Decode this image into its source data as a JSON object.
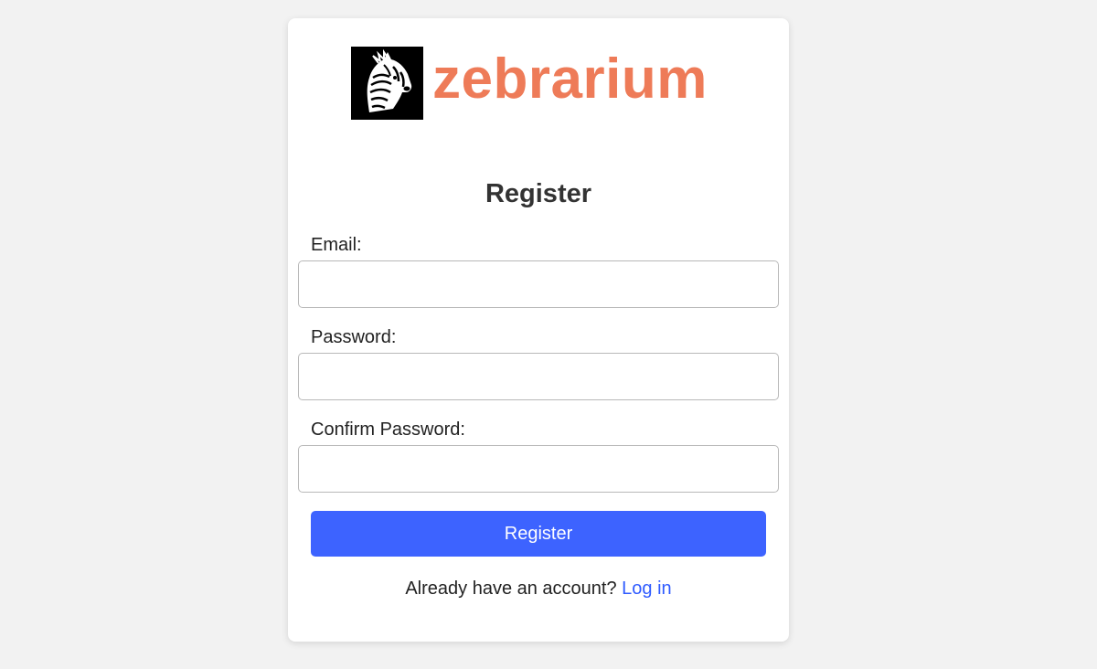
{
  "brand": {
    "logo_icon": "zebra-head-icon",
    "name": "zebrarium",
    "name_color": "#ee7b58"
  },
  "form": {
    "title": "Register",
    "fields": [
      {
        "label": "Email:",
        "value": "",
        "placeholder": ""
      },
      {
        "label": "Password:",
        "value": "",
        "placeholder": ""
      },
      {
        "label": "Confirm Password:",
        "value": "",
        "placeholder": ""
      }
    ],
    "submit_label": "Register",
    "submit_color": "#3d63ff"
  },
  "footer": {
    "prompt": "Already have an account?",
    "link_label": "Log in",
    "link_color": "#2f5bff"
  }
}
